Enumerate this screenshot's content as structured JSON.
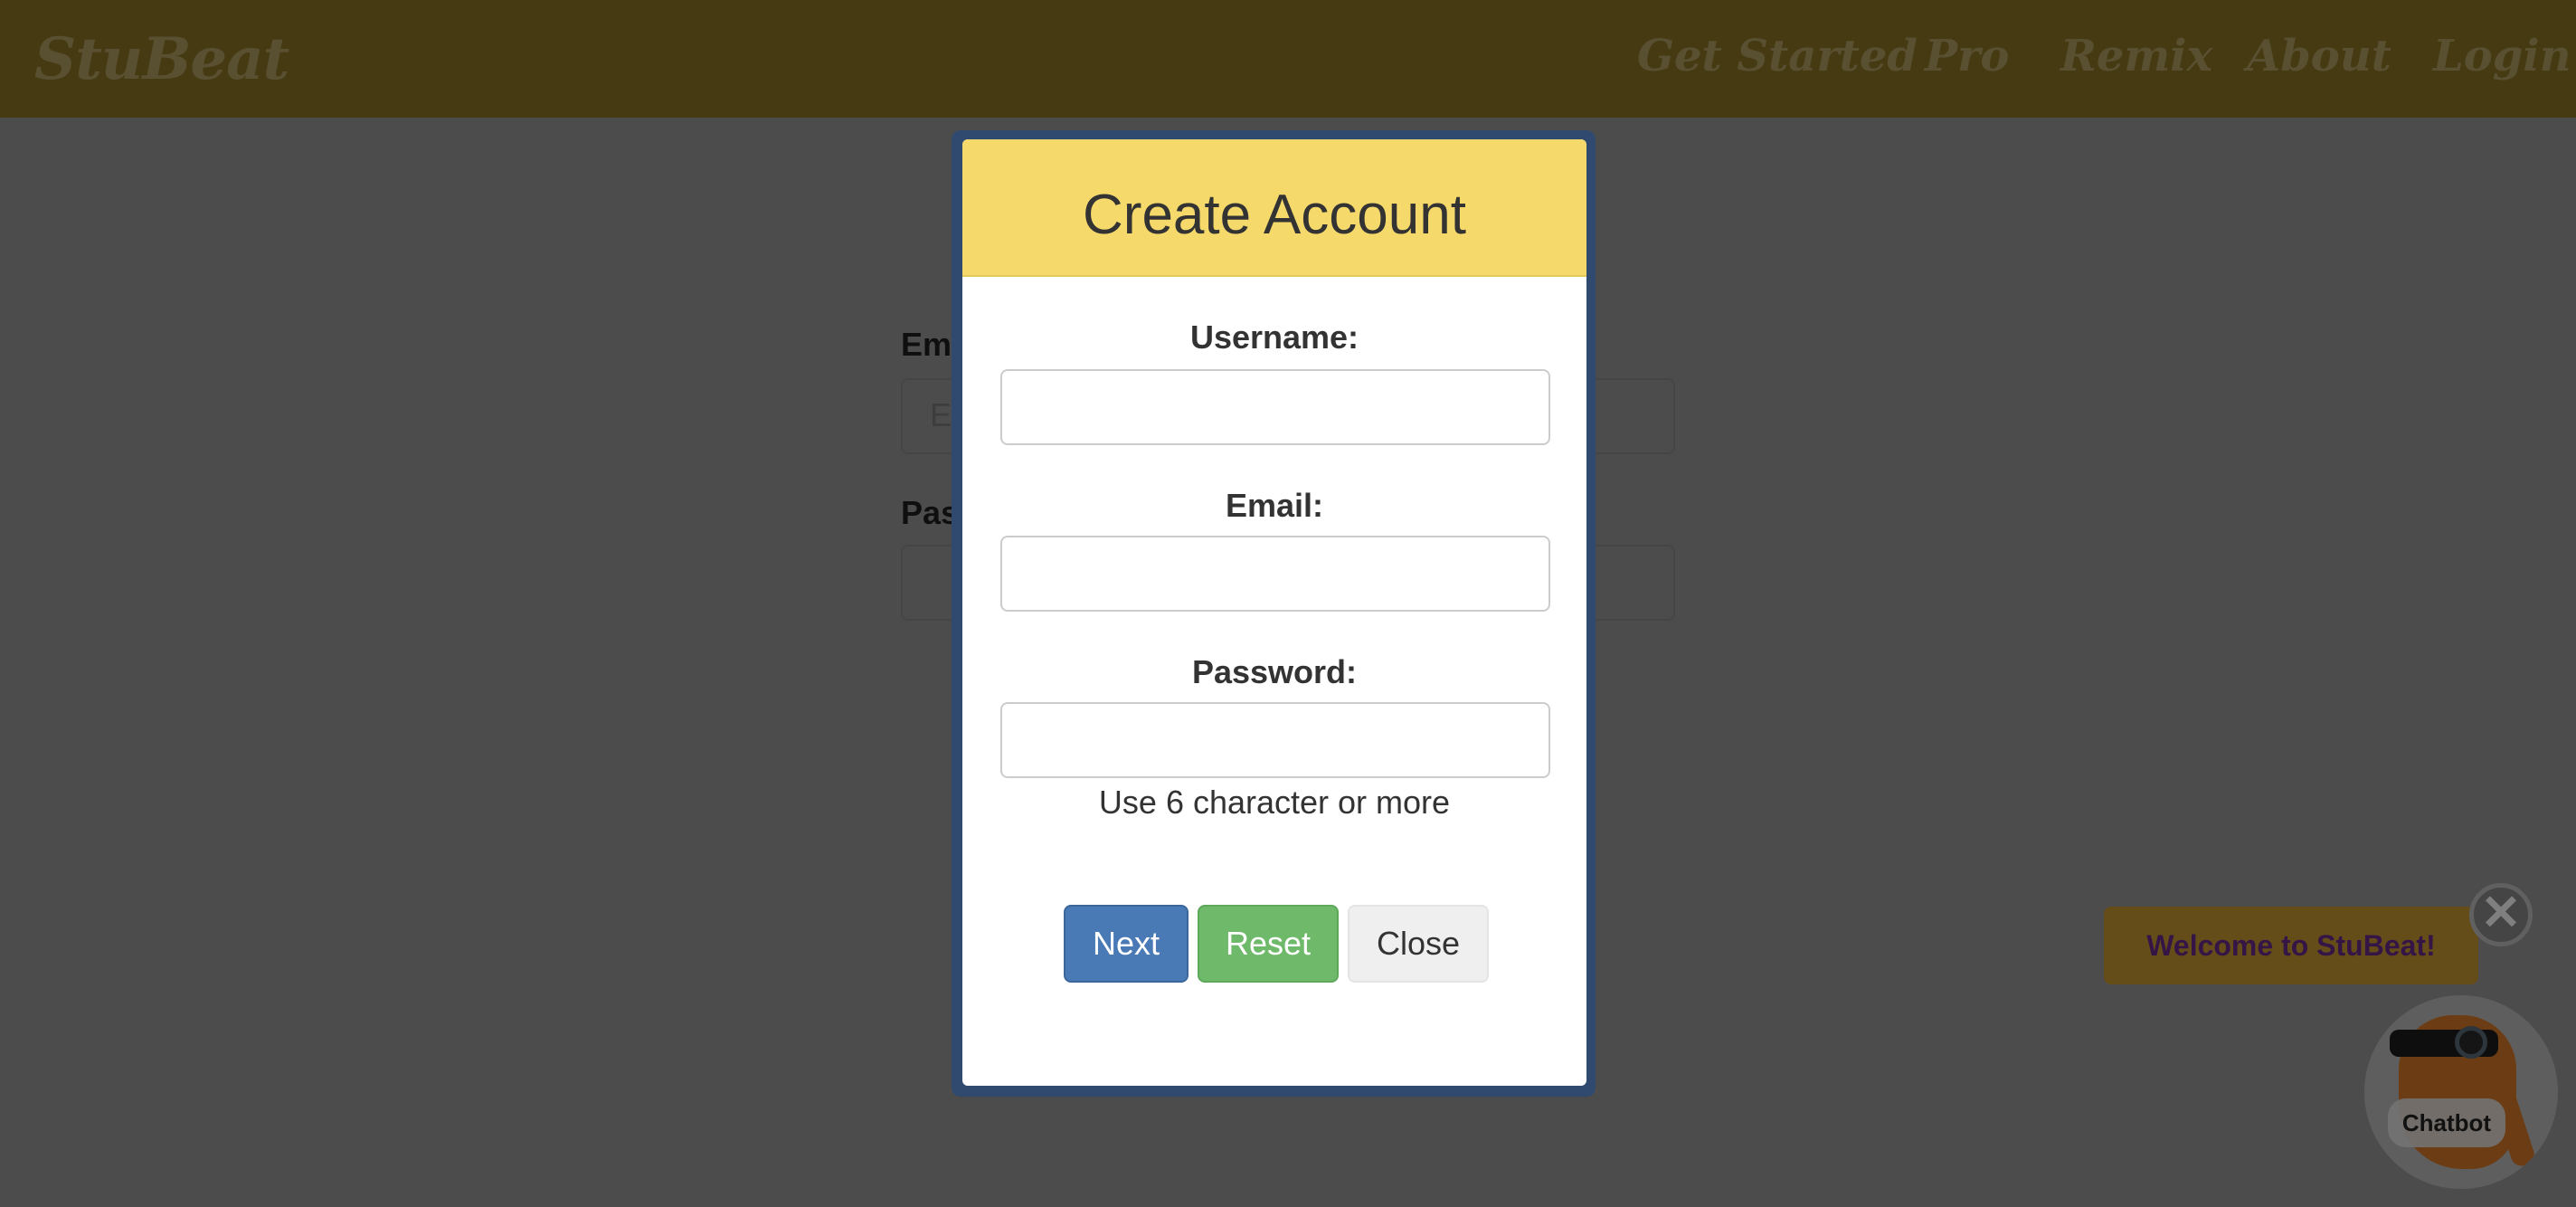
{
  "nav": {
    "brand": "StuBeat",
    "items": [
      "Get Started",
      "Pro",
      "Remix",
      "About",
      "Login"
    ]
  },
  "background_form": {
    "email_label": "Em",
    "email_placeholder": "E",
    "password_label": "Pas"
  },
  "modal": {
    "title": "Create Account",
    "username_label": "Username:",
    "email_label": "Email:",
    "password_label": "Password:",
    "username_value": "",
    "email_value": "",
    "password_value": "",
    "password_hint": "Use 6 character or more",
    "next_label": "Next",
    "reset_label": "Reset",
    "close_label": "Close"
  },
  "chatbot": {
    "welcome_text": "Welcome to StuBeat!",
    "close_glyph": "✕",
    "bot_label": "Chatbot"
  },
  "colors": {
    "header_yellow": "#f5d96a",
    "next_blue": "#4a7ab5",
    "reset_green": "#6fba6a",
    "modal_border": "#2f4a6e"
  }
}
